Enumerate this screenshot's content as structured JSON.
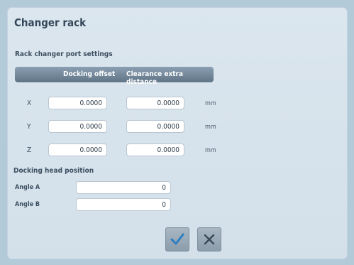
{
  "dialog": {
    "title": "Changer rack"
  },
  "rack_settings": {
    "section_label": "Rack changer port settings",
    "columns": {
      "docking_offset": "Docking offset",
      "clearance_extra_distance": "Clearance extra distance"
    },
    "rows": [
      {
        "axis": "X",
        "docking_offset": "0.0000",
        "clearance": "0.0000",
        "unit": "mm"
      },
      {
        "axis": "Y",
        "docking_offset": "0.0000",
        "clearance": "0.0000",
        "unit": "mm"
      },
      {
        "axis": "Z",
        "docking_offset": "0.0000",
        "clearance": "0.0000",
        "unit": "mm"
      }
    ]
  },
  "docking_head": {
    "section_label": "Docking head position",
    "angle_a_label": "Angle A",
    "angle_a_value": "0",
    "angle_b_label": "Angle B",
    "angle_b_value": "0"
  },
  "actions": {
    "confirm_icon": "checkmark-icon",
    "cancel_icon": "close-icon"
  },
  "colors": {
    "page_background": "#b3cad9",
    "dialog_background": "#dbe6ee",
    "header_bar": "#6f8496",
    "button": "#97a7b5",
    "confirm_check": "#2f7fc0",
    "cancel_x": "#3c4a57"
  }
}
